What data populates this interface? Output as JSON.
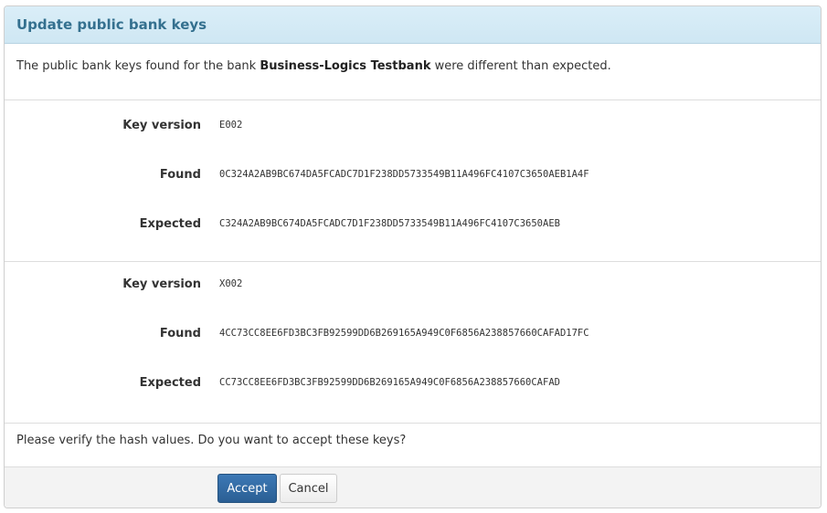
{
  "dialog": {
    "title": "Update public bank keys",
    "intro_prefix": "The public bank keys found for the bank ",
    "bank_name": "Business-Logics Testbank",
    "intro_suffix": " were different than expected.",
    "question": "Please verify the hash values. Do you want to accept these keys?"
  },
  "labels": {
    "key_version": "Key version",
    "found": "Found",
    "expected": "Expected"
  },
  "keys": [
    {
      "version": "E002",
      "found": "0C324A2AB9BC674DA5FCADC7D1F238DD5733549B11A496FC4107C3650AEB1A4F",
      "expected": "C324A2AB9BC674DA5FCADC7D1F238DD5733549B11A496FC4107C3650AEB"
    },
    {
      "version": "X002",
      "found": "4CC73CC8EE6FD3BC3FB92599DD6B269165A949C0F6856A238857660CAFAD17FC",
      "expected": "CC73CC8EE6FD3BC3FB92599DD6B269165A949C0F6856A238857660CAFAD"
    }
  ],
  "buttons": {
    "accept": "Accept",
    "cancel": "Cancel"
  }
}
